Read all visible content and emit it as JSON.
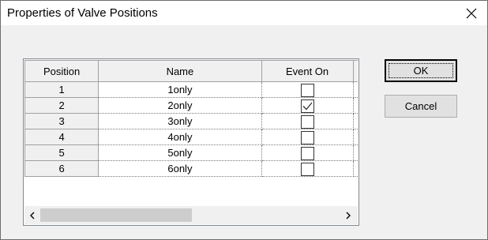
{
  "window": {
    "title": "Properties of Valve Positions"
  },
  "grid": {
    "columns": [
      "Position",
      "Name",
      "Event On"
    ],
    "rows": [
      {
        "position": "1",
        "name": "1only",
        "event_on": false
      },
      {
        "position": "2",
        "name": "2only",
        "event_on": true
      },
      {
        "position": "3",
        "name": "3only",
        "event_on": false
      },
      {
        "position": "4",
        "name": "4only",
        "event_on": false
      },
      {
        "position": "5",
        "name": "5only",
        "event_on": false
      },
      {
        "position": "6",
        "name": "6only",
        "event_on": false
      }
    ]
  },
  "buttons": {
    "ok_label": "OK",
    "cancel_label": "Cancel"
  },
  "icons": {
    "close": "close-icon",
    "scroll_left": "chevron-left-icon",
    "scroll_right": "chevron-right-icon",
    "checkmark": "checkmark-icon"
  },
  "colors": {
    "dialog_bg": "#f0f0f0",
    "header_bg": "#f0f0f0",
    "grid_bg": "#ffffff"
  }
}
